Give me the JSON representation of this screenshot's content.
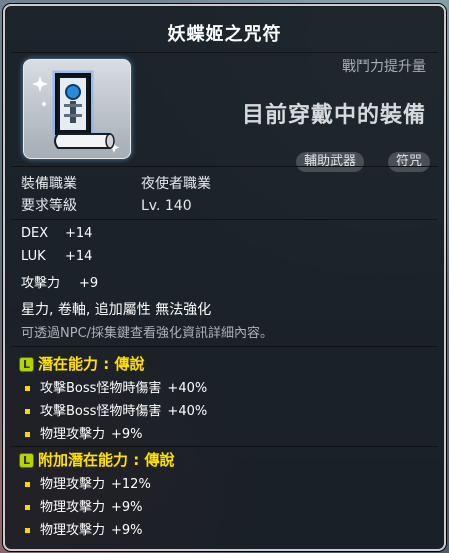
{
  "title": "妖蝶姬之咒符",
  "side": {
    "power_label": "戰鬥力提升量",
    "equipped_label": "目前穿戴中的裝備"
  },
  "tags": [
    "輔助武器",
    "符咒"
  ],
  "info": [
    {
      "key": "裝備職業",
      "value": "夜使者職業"
    },
    {
      "key": "要求等級",
      "value": "Lv. 140"
    }
  ],
  "stats": [
    {
      "key": "DEX",
      "value": "+14"
    },
    {
      "key": "LUK",
      "value": "+14"
    },
    {
      "key": "攻擊力",
      "value": "+9"
    }
  ],
  "notes": {
    "attributes": "星力, 卷軸, 追加屬性 無法強化",
    "hint": "可透過NPC/採集鍵查看強化資訊詳細內容。"
  },
  "potential": {
    "badge": "L",
    "label": "潛在能力 : 傳說",
    "lines": [
      {
        "text": "攻擊Boss怪物時傷害",
        "value": "+40%"
      },
      {
        "text": "攻擊Boss怪物時傷害",
        "value": "+40%"
      },
      {
        "text": "物理攻擊力",
        "value": "+9%"
      }
    ]
  },
  "additional_potential": {
    "badge": "L",
    "label": "附加潛在能力 : 傳說",
    "lines": [
      {
        "text": "物理攻擊力",
        "value": "+12%"
      },
      {
        "text": "物理攻擊力",
        "value": "+9%"
      },
      {
        "text": "物理攻擊力",
        "value": "+9%"
      }
    ]
  },
  "colors": {
    "potential_header": "#ffe000",
    "legend_badge": "#b6d400",
    "bullet": "#ffd600"
  },
  "icons": {
    "item": "talisman-scroll-icon",
    "legend": "legendary-grade-icon",
    "bullet": "square-bullet-icon"
  }
}
